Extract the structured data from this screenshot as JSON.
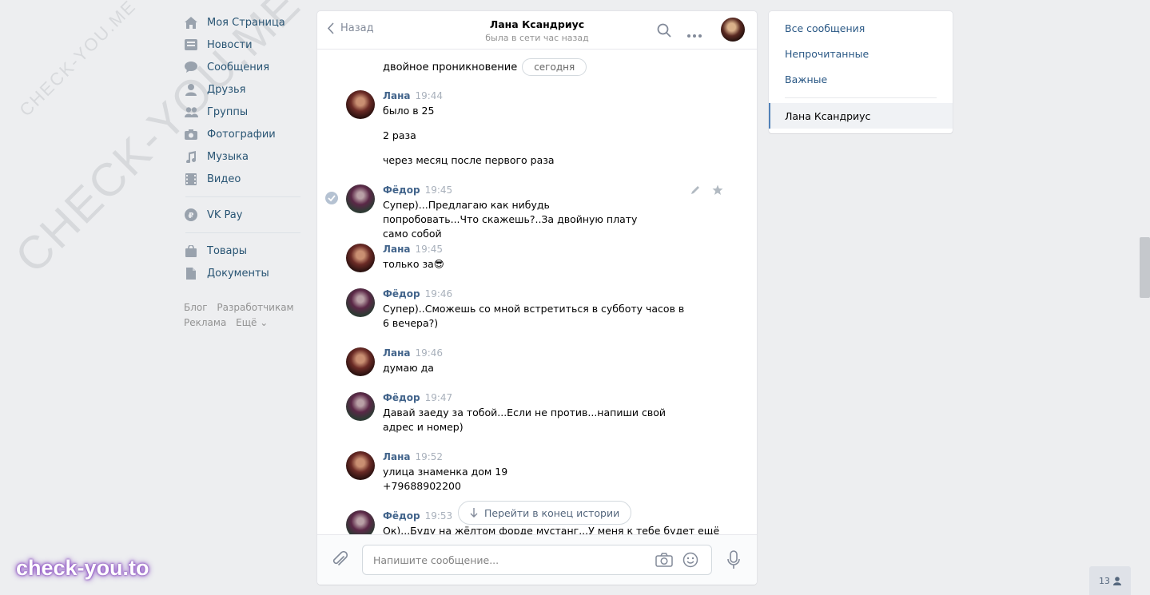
{
  "watermarks": {
    "diagonal_large": "CHECK-YOU.ME",
    "diagonal_small": "CHECK-YOU.ME",
    "badge": "check-you.to"
  },
  "leftnav": {
    "items": [
      {
        "label": "Моя Страница",
        "icon": "home-icon"
      },
      {
        "label": "Новости",
        "icon": "news-icon"
      },
      {
        "label": "Сообщения",
        "icon": "messages-icon"
      },
      {
        "label": "Друзья",
        "icon": "friends-icon"
      },
      {
        "label": "Группы",
        "icon": "groups-icon"
      },
      {
        "label": "Фотографии",
        "icon": "camera-icon"
      },
      {
        "label": "Музыка",
        "icon": "music-icon"
      },
      {
        "label": "Видео",
        "icon": "video-icon"
      }
    ],
    "pay": {
      "label": "VK Pay",
      "icon": "vkpay-icon"
    },
    "extra": [
      {
        "label": "Товары",
        "icon": "bag-icon"
      },
      {
        "label": "Документы",
        "icon": "document-icon"
      }
    ],
    "footer": {
      "blog": "Блог",
      "dev": "Разработчикам",
      "ads": "Реклама",
      "more": "Ещё ⌄"
    }
  },
  "chat": {
    "back_label": "Назад",
    "contact_name": "Лана Ксандриус",
    "contact_status": "была в сети час назад",
    "first_line": "двойное проникновение",
    "date_pill": "сегодня",
    "messages": [
      {
        "author": "Лана",
        "time": "19:44",
        "lines": [
          "было в 25",
          "2 раза",
          "через месяц после первого раза"
        ]
      },
      {
        "author": "Фёдор",
        "time": "19:45",
        "lines": [
          "Супер)...Предлагаю как нибудь попробовать...Что скажешь?..За двойную плату само собой"
        ]
      },
      {
        "author": "Лана",
        "time": "19:45",
        "lines": [
          "только за😎"
        ]
      },
      {
        "author": "Фёдор",
        "time": "19:46",
        "lines": [
          "Супер)..Сможешь со мной встретиться в субботу часов в 6 вечера?)"
        ]
      },
      {
        "author": "Лана",
        "time": "19:46",
        "lines": [
          "думаю да"
        ]
      },
      {
        "author": "Фёдор",
        "time": "19:47",
        "lines": [
          "Давай заеду за тобой...Если не против...напиши свой адрес и номер)"
        ]
      },
      {
        "author": "Лана",
        "time": "19:52",
        "lines": [
          "улица знаменка дом 19",
          "+79688902200"
        ]
      },
      {
        "author": "Фёдор",
        "time": "19:53",
        "lines": [
          "Ок)...Буду на жёлтом форде мустанг...У меня к тебе будет ещё"
        ]
      }
    ],
    "jump_label": "Перейти в конец истории",
    "input_placeholder": "Напишите сообщение..."
  },
  "rightpanel": {
    "all": "Все сообщения",
    "unread": "Непрочитанные",
    "important": "Важные",
    "active_chat": "Лана Ксандриус"
  },
  "online_count": "13"
}
